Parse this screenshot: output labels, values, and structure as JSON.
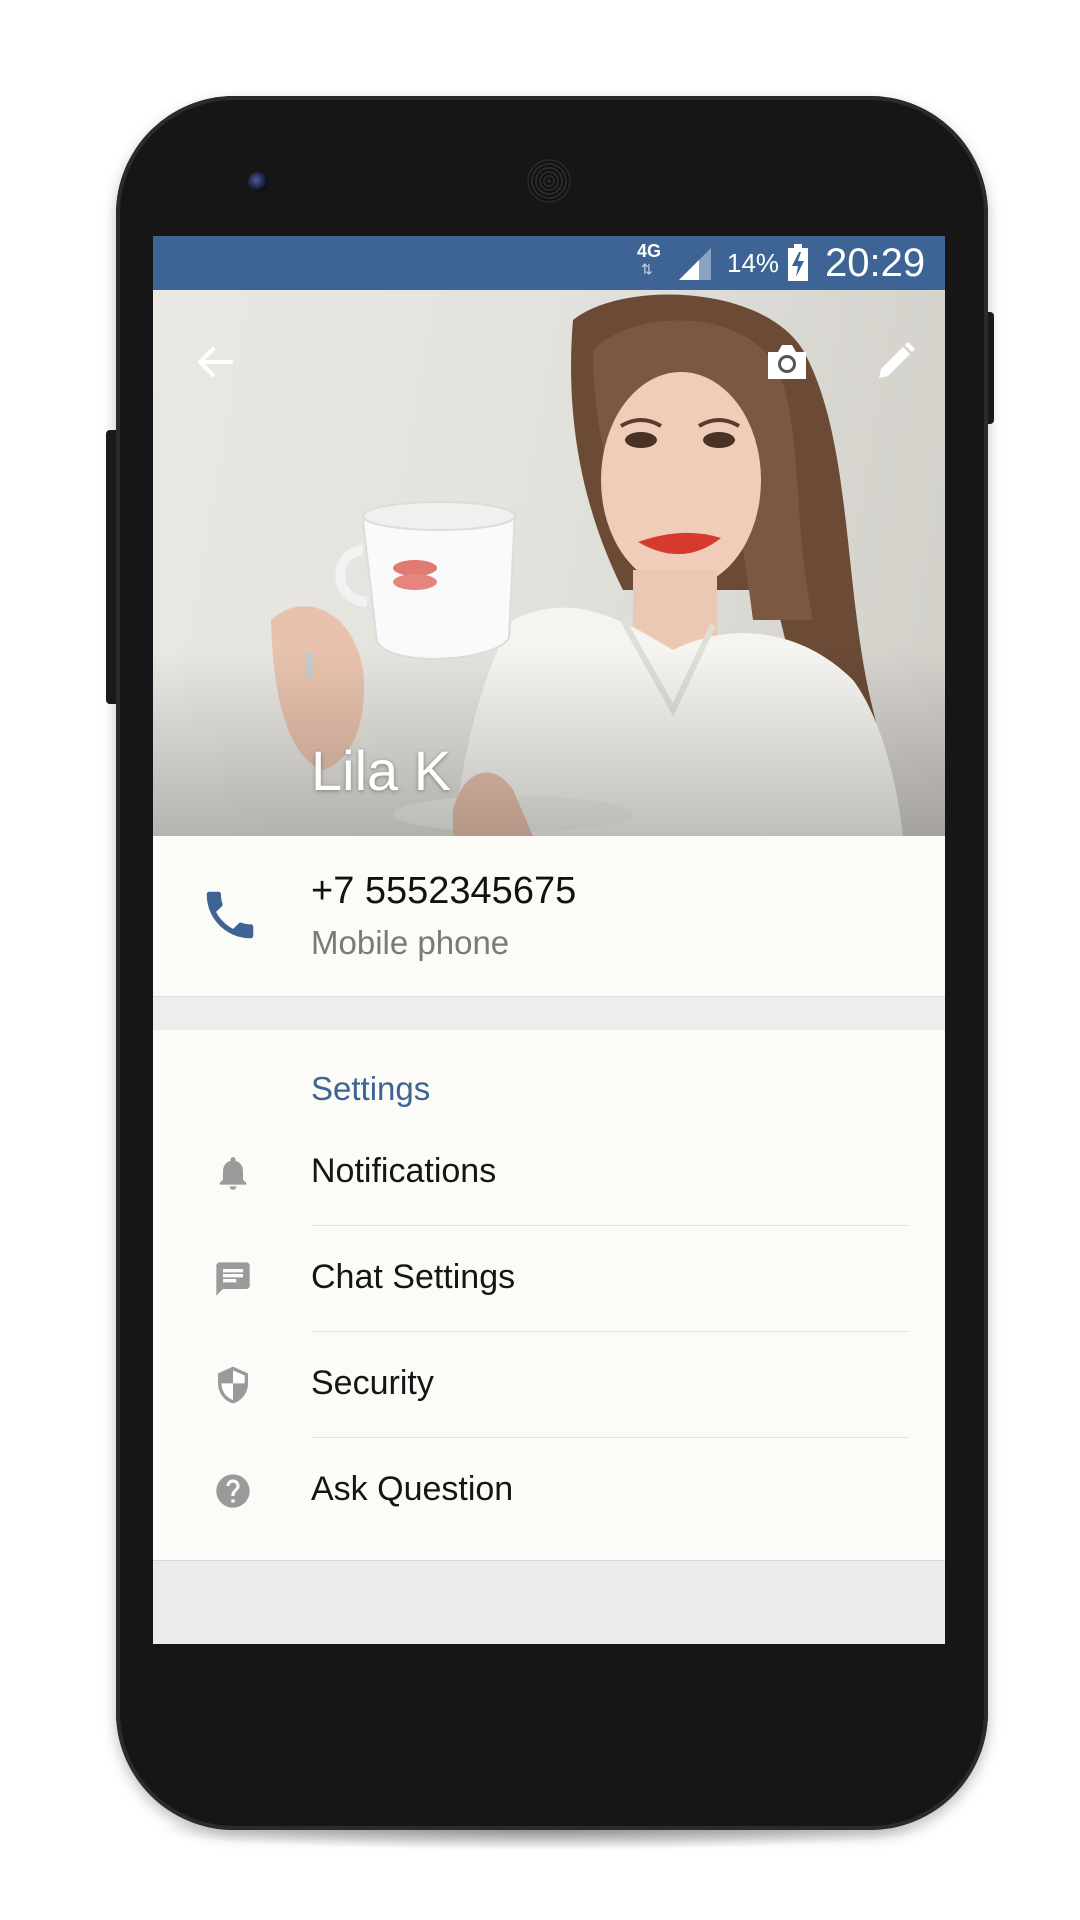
{
  "status_bar": {
    "network": "4G",
    "network_arrows": "⇅",
    "battery_percent": "14%",
    "time": "20:29",
    "color": "#3d6494"
  },
  "header": {
    "contact_name": "Lila K",
    "icons": [
      "back-arrow-icon",
      "camera-icon",
      "pencil-icon"
    ]
  },
  "contact": {
    "phone_number": "+7 5552345675",
    "phone_type": "Mobile phone",
    "icon": "phone-icon",
    "accent": "#3d6494"
  },
  "settings": {
    "title": "Settings",
    "items": [
      {
        "label": "Notifications",
        "icon": "bell-icon"
      },
      {
        "label": "Chat Settings",
        "icon": "chat-icon"
      },
      {
        "label": "Security",
        "icon": "shield-icon"
      },
      {
        "label": "Ask Question",
        "icon": "help-icon"
      }
    ]
  }
}
